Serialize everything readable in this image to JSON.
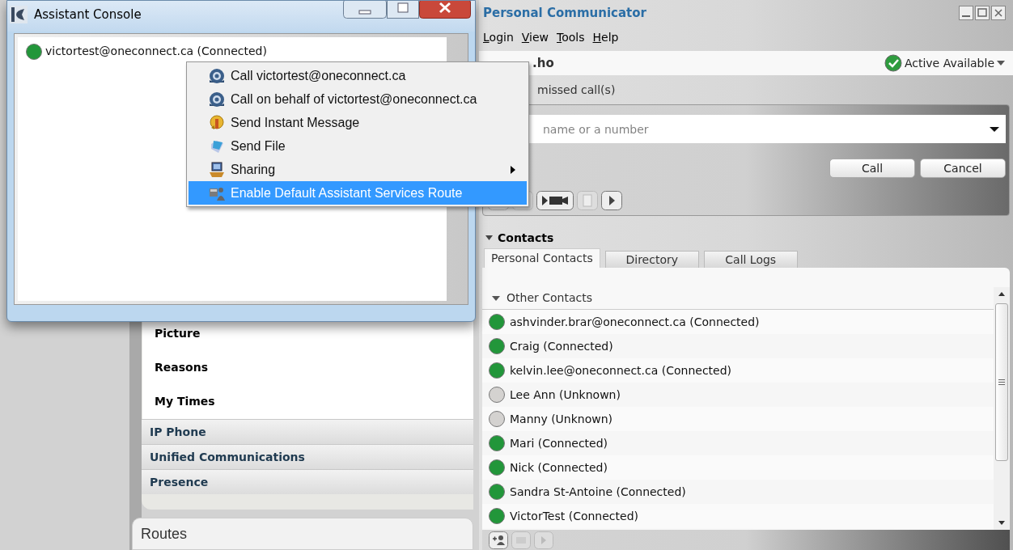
{
  "settings_panel": {
    "sub_items": [
      "Picture",
      "Reasons",
      "My Times"
    ],
    "sections": [
      "IP Phone",
      "Unified Communications",
      "Presence"
    ],
    "routes_title": "Routes"
  },
  "communicator": {
    "title": "Personal Communicator",
    "menu": [
      "Login",
      "View",
      "Tools",
      "Help"
    ],
    "user": ".ho",
    "status": "Active Available",
    "missed_calls": "missed call(s)",
    "search": {
      "placeholder": "name or a number"
    },
    "buttons": [
      "Call",
      "Cancel"
    ],
    "contacts_title": "Contacts",
    "tabs": [
      {
        "label": "Personal Contacts",
        "selected": true
      },
      {
        "label": "Directory",
        "selected": false
      },
      {
        "label": "Call Logs",
        "selected": false
      }
    ],
    "group": {
      "label": "Other Contacts",
      "expanded": true
    },
    "contacts": [
      {
        "label": "ashvinder.brar@oneconnect.ca (Connected)",
        "color": "#22963a"
      },
      {
        "label": "Craig (Connected)",
        "color": "#22963a"
      },
      {
        "label": "kelvin.lee@oneconnect.ca (Connected)",
        "color": "#22963a"
      },
      {
        "label": "Lee Ann (Unknown)",
        "color": "#d4d2d0"
      },
      {
        "label": "Manny (Unknown)",
        "color": "#d4d2d0"
      },
      {
        "label": "Mari (Connected)",
        "color": "#22963a"
      },
      {
        "label": "Nick (Connected)",
        "color": "#22963a"
      },
      {
        "label": "Sandra St-Antoine (Connected)",
        "color": "#22963a"
      },
      {
        "label": "VictorTest (Connected)",
        "color": "#22963a"
      }
    ]
  },
  "assistant_console": {
    "title": "Assistant Console",
    "contacts": [
      {
        "label": "victortest@oneconnect.ca (Connected)",
        "color": "#22963a"
      }
    ]
  },
  "context_menu": {
    "items": [
      {
        "label": "Call victortest@oneconnect.ca",
        "kind": "phone",
        "selected": false,
        "submenu": false
      },
      {
        "label": "Call on behalf of victortest@oneconnect.ca",
        "kind": "phone",
        "selected": false,
        "submenu": false
      },
      {
        "label": "Send Instant Message",
        "kind": "message",
        "selected": false,
        "submenu": false
      },
      {
        "label": "Send File",
        "kind": "file",
        "selected": false,
        "submenu": false
      },
      {
        "label": "Sharing",
        "kind": "sharing",
        "selected": false,
        "submenu": true
      },
      {
        "label": "Enable Default Assistant Services Route",
        "kind": "route",
        "selected": true,
        "submenu": false
      }
    ]
  }
}
